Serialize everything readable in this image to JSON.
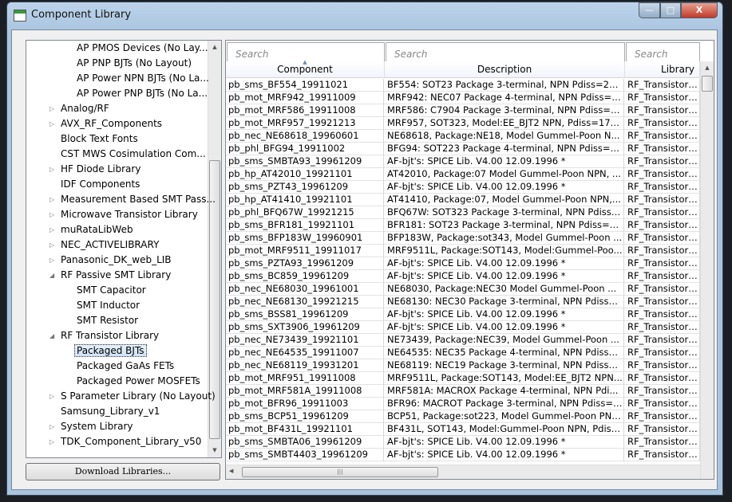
{
  "window": {
    "title": "Component Library",
    "minimize": "—",
    "maximize": "□",
    "close": "X"
  },
  "tree": {
    "items": [
      {
        "label": "AP PMOS Devices (No Lay...",
        "level": 2
      },
      {
        "label": "AP PNP BJTs (No Layout)",
        "level": 2
      },
      {
        "label": "AP Power NPN BJTs (No La...",
        "level": 2
      },
      {
        "label": "AP Power PNP BJTs (No La...",
        "level": 2
      },
      {
        "label": "Analog/RF",
        "level": 1,
        "expander": "collapsed"
      },
      {
        "label": "AVX_RF_Components",
        "level": 1,
        "expander": "collapsed"
      },
      {
        "label": "Block Text Fonts",
        "level": 1
      },
      {
        "label": "CST MWS Cosimulation Com...",
        "level": 1
      },
      {
        "label": "HF Diode Library",
        "level": 1,
        "expander": "collapsed"
      },
      {
        "label": "IDF Components",
        "level": 1
      },
      {
        "label": "Measurement Based SMT Pass...",
        "level": 1,
        "expander": "collapsed"
      },
      {
        "label": "Microwave Transistor Library",
        "level": 1,
        "expander": "collapsed"
      },
      {
        "label": "muRataLibWeb",
        "level": 1,
        "expander": "collapsed"
      },
      {
        "label": "NEC_ACTIVELIBRARY",
        "level": 1,
        "expander": "collapsed"
      },
      {
        "label": "Panasonic_DK_web_LIB",
        "level": 1,
        "expander": "collapsed"
      },
      {
        "label": "RF Passive SMT Library",
        "level": 1,
        "expander": "expanded"
      },
      {
        "label": "SMT Capacitor",
        "level": 2
      },
      {
        "label": "SMT Inductor",
        "level": 2
      },
      {
        "label": "SMT Resistor",
        "level": 2
      },
      {
        "label": "RF Transistor Library",
        "level": 1,
        "expander": "expanded"
      },
      {
        "label": "Packaged BJTs",
        "level": 2,
        "selected": true
      },
      {
        "label": "Packaged GaAs FETs",
        "level": 2
      },
      {
        "label": "Packaged Power MOSFETs",
        "level": 2
      },
      {
        "label": "S Parameter Library (No Layout)",
        "level": 1,
        "expander": "collapsed"
      },
      {
        "label": "Samsung_Library_v1",
        "level": 1
      },
      {
        "label": "System Library",
        "level": 1,
        "expander": "collapsed"
      },
      {
        "label": "TDK_Component_Library_v50",
        "level": 1,
        "expander": "collapsed"
      }
    ]
  },
  "download_button": "Download Libraries...",
  "table": {
    "search_placeholders": [
      "Search",
      "Search",
      "Search"
    ],
    "columns": [
      "Component",
      "Description",
      "Library"
    ],
    "sorted_column": "Component",
    "rows": [
      [
        "pb_sms_BF554_19911021",
        "BF554: SOT23 Package 3-terminal, NPN Pdiss=280...",
        "RF_Transistor_L..."
      ],
      [
        "pb_mot_MRF942_19911009",
        "MRF942: NEC07 Package 4-terminal, NPN Pdiss=2...",
        "RF_Transistor_L..."
      ],
      [
        "pb_mot_MRF586_19911008",
        "MRF586: C7904 Package 3-terminal, NPN Pdiss=2...",
        "RF_Transistor_L..."
      ],
      [
        "pb_mot_MRF957_19921213",
        "MRF957, SOT323, Model:EE_BJT2 NPN, Pdiss=175...",
        "RF_Transistor_L..."
      ],
      [
        "pb_nec_NE68618_19960601",
        "NE68618, Package:NE18, Model Gummel-Poon N...",
        "RF_Transistor_L..."
      ],
      [
        "pb_phl_BFG94_19911002",
        "BFG94: SOT223 Package 4-terminal, NPN Pdiss=70...",
        "RF_Transistor_L..."
      ],
      [
        "pb_sms_SMBTA93_19961209",
        "AF-bjt's: SPICE Lib. V4.00 12.09.1996 *",
        "RF_Transistor_L..."
      ],
      [
        "pb_hp_AT42010_19921101",
        "AT42010, Package:07 Model Gummel-Poon NPN, ...",
        "RF_Transistor_L..."
      ],
      [
        "pb_sms_PZT43_19961209",
        "AF-bjt's: SPICE Lib. V4.00 12.09.1996 *",
        "RF_Transistor_L..."
      ],
      [
        "pb_hp_AT41410_19921101",
        "AT41410, Package:07, Model Gummel-Poon NPN,...",
        "RF_Transistor_L..."
      ],
      [
        "pb_phl_BFQ67W_19921215",
        "BFQ67W: SOT323 Package 3-terminal, NPN Pdiss=...",
        "RF_Transistor_L..."
      ],
      [
        "pb_sms_BFR181_19921101",
        "BFR181: SOT23 Package 3-terminal, NPN Pdiss=30...",
        "RF_Transistor_L..."
      ],
      [
        "pb_sms_BFP183W_19960901",
        "BFP183W, Package:sot343, Model Gummel-Poon ...",
        "RF_Transistor_L..."
      ],
      [
        "pb_mot_MRF9511_19911017",
        "MRF9511L, Package:SOT143, Model:Gummel-Poo...",
        "RF_Transistor_L..."
      ],
      [
        "pb_sms_PZTA93_19961209",
        "AF-bjt's: SPICE Lib. V4.00 12.09.1996 *",
        "RF_Transistor_L..."
      ],
      [
        "pb_sms_BC859_19961209",
        "AF-bjt's: SPICE Lib. V4.00 12.09.1996 *",
        "RF_Transistor_L..."
      ],
      [
        "pb_nec_NE68030_19961001",
        "NE68030, Package:NEC30 Model Gummel-Poon ...",
        "RF_Transistor_L..."
      ],
      [
        "pb_nec_NE68130_19921215",
        "NE68130: NEC30 Package 3-terminal, NPN Pdiss=...",
        "RF_Transistor_L..."
      ],
      [
        "pb_sms_BSS81_19961209",
        "AF-bjt's: SPICE Lib. V4.00 12.09.1996 *",
        "RF_Transistor_L..."
      ],
      [
        "pb_sms_SXT3906_19961209",
        "AF-bjt's: SPICE Lib. V4.00 12.09.1996 *",
        "RF_Transistor_L..."
      ],
      [
        "pb_nec_NE73439_19921101",
        "NE73439, Package:NEC39, Model Gummel-Poon ...",
        "RF_Transistor_L..."
      ],
      [
        "pb_nec_NE64535_19911007",
        "NE64535: NEC35 Package 4-terminal, NPN Pdiss=...",
        "RF_Transistor_L..."
      ],
      [
        "pb_nec_NE68119_19931201",
        "NE68119: NEC19 Package 3-terminal, NPN Pdiss=...",
        "RF_Transistor_L..."
      ],
      [
        "pb_mot_MRF951_19911008",
        "MRF9511L, Package:SOT143, Model:EE_BJT2 NPN...",
        "RF_Transistor_L..."
      ],
      [
        "pb_mot_MRF581A_19911008",
        "MRF581A: MACROX Package 4-terminal, NPN Pdi...",
        "RF_Transistor_L..."
      ],
      [
        "pb_mot_BFR96_19911003",
        "BFR96: MACROT Package 3-terminal, NPN Pdiss=5...",
        "RF_Transistor_L..."
      ],
      [
        "pb_sms_BCP51_19961209",
        "BCP51, Package:sot223, Model Gummel-Poon PNP...",
        "RF_Transistor_L..."
      ],
      [
        "pb_mot_BF431L_19921101",
        "BF431L, SOT143, Model:Gummel-Poon NPN, Pdiss...",
        "RF_Transistor_L..."
      ],
      [
        "pb_sms_SMBTA06_19961209",
        "AF-bjt's: SPICE Lib. V4.00 12.09.1996 *",
        "RF_Transistor_L..."
      ],
      [
        "pb_sms_SMBT4403_19961209",
        "AF-bjt's: SPICE Lib. V4.00 12.09.1996 *",
        "RF_Transistor_L..."
      ]
    ]
  }
}
